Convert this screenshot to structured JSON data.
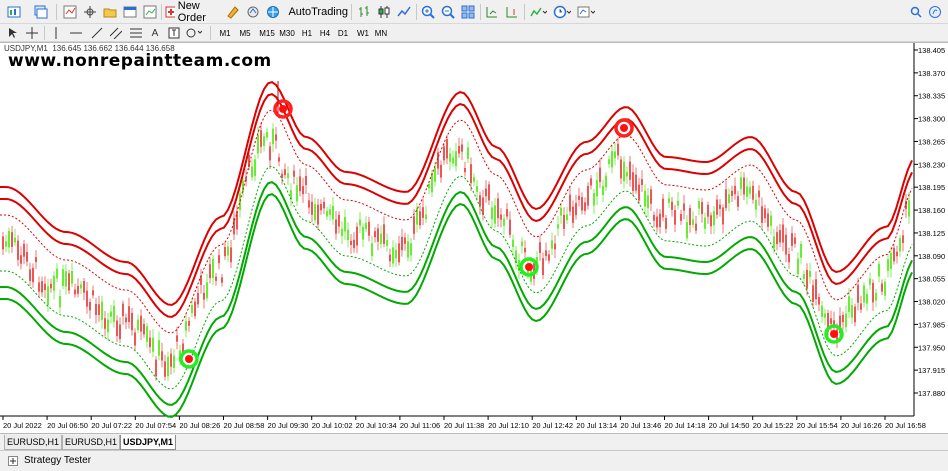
{
  "toolbar": {
    "new_order_label": "New Order",
    "autotrading_label": "AutoTrading",
    "timeframes": [
      "M1",
      "M5",
      "M15",
      "M30",
      "H1",
      "H4",
      "D1",
      "W1",
      "MN"
    ]
  },
  "chart": {
    "header": "USDJPY,M1  136.645 136.662 136.644 136.658",
    "watermark": "www.nonrepaintteam.com",
    "y_ticks": [
      "138.405",
      "138.370",
      "138.335",
      "138.300",
      "138.265",
      "138.230",
      "138.195",
      "138.160",
      "138.125",
      "138.090",
      "138.055",
      "138.020",
      "137.985",
      "137.950",
      "137.915",
      "137.880"
    ],
    "x_ticks": [
      "20 Jul 2022",
      "20 Jul 06:50",
      "20 Jul 07:22",
      "20 Jul 07:54",
      "20 Jul 08:26",
      "20 Jul 08:58",
      "20 Jul 09:30",
      "20 Jul 10:02",
      "20 Jul 10:34",
      "20 Jul 11:06",
      "20 Jul 11:38",
      "20 Jul 12:10",
      "20 Jul 12:42",
      "20 Jul 13:14",
      "20 Jul 13:46",
      "20 Jul 14:18",
      "20 Jul 14:50",
      "20 Jul 15:22",
      "20 Jul 15:54",
      "20 Jul 16:26",
      "20 Jul 16:58"
    ]
  },
  "tabs": [
    "EURUSD,H1",
    "EURUSD,H1",
    "USDJPY,M1"
  ],
  "active_tab": "USDJPY,M1",
  "status": {
    "strategy_tester_label": "Strategy Tester"
  },
  "colors": {
    "bull": "#66ee33",
    "bear": "#ee5555",
    "upper_band": "#dd0000",
    "lower_band": "#00aa00",
    "signal_ring_up": "#ff2020",
    "signal_ring_down": "#22ee22"
  }
}
